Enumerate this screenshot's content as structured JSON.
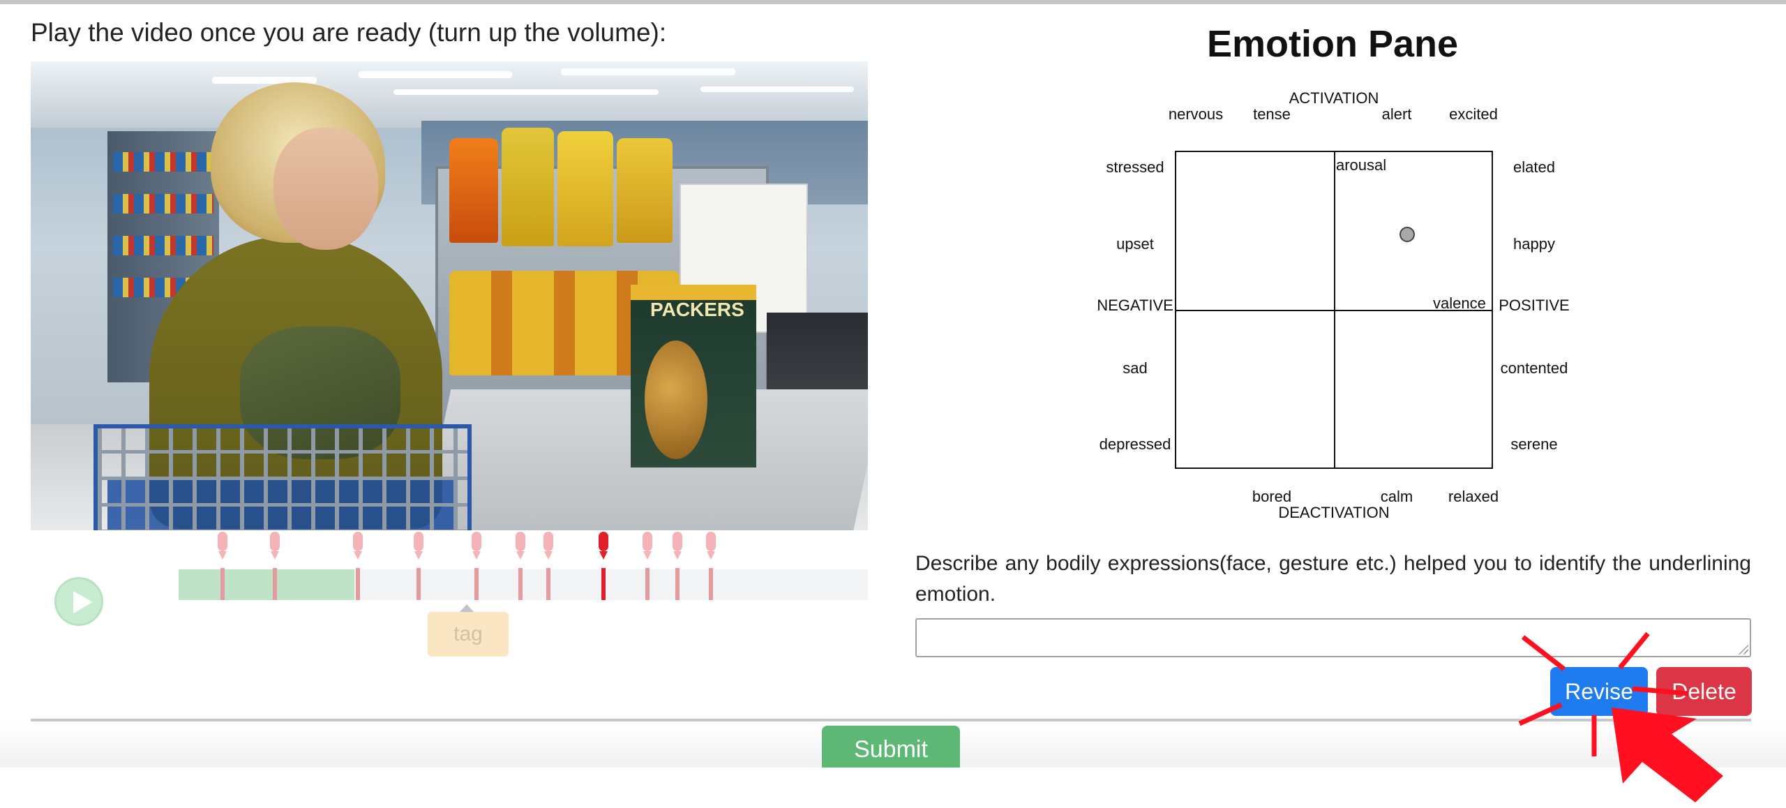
{
  "prompt": "Play the video once you are ready (turn up the volume):",
  "video": {
    "box_label": "PACKERS"
  },
  "player": {
    "progress_fraction": 0.255,
    "tag_label": "tag",
    "play_icon": "play-icon",
    "markers": [
      {
        "position": 0.016,
        "active": false
      },
      {
        "position": 0.035,
        "active": false
      },
      {
        "position": 0.065,
        "active": false
      },
      {
        "position": 0.087,
        "active": false
      },
      {
        "position": 0.108,
        "active": false
      },
      {
        "position": 0.124,
        "active": false
      },
      {
        "position": 0.134,
        "active": false
      },
      {
        "position": 0.154,
        "active": true
      },
      {
        "position": 0.17,
        "active": false
      },
      {
        "position": 0.181,
        "active": false
      },
      {
        "position": 0.193,
        "active": false
      }
    ]
  },
  "emotion_pane": {
    "title": "Emotion Pane",
    "axis": {
      "activation": "ACTIVATION",
      "deactivation": "DEACTIVATION",
      "negative": "NEGATIVE",
      "positive": "POSITIVE",
      "arousal": "arousal",
      "valence": "valence"
    },
    "top_labels": [
      "nervous",
      "tense",
      "alert",
      "excited"
    ],
    "bottom_labels": [
      "bored",
      "calm",
      "relaxed"
    ],
    "left_labels": [
      "stressed",
      "upset",
      "sad",
      "depressed"
    ],
    "right_labels": [
      "elated",
      "happy",
      "contented",
      "serene"
    ],
    "selected_point": {
      "valence": 0.46,
      "arousal": 0.48
    }
  },
  "description": {
    "prompt": "Describe any bodily expressions(face, gesture etc.) helped you to identify the underlining emotion.",
    "value": "",
    "placeholder": ""
  },
  "buttons": {
    "revise": "Revise",
    "delete": "Delete",
    "submit": "Submit"
  },
  "colors": {
    "revise": "#1e7bf0",
    "delete": "#dc3545",
    "submit": "#5cb874",
    "progress": "#bfe3c7",
    "marker": "#f4b3b6",
    "marker_active": "#e0202a",
    "annotation_arrow": "#ff0f1f"
  }
}
